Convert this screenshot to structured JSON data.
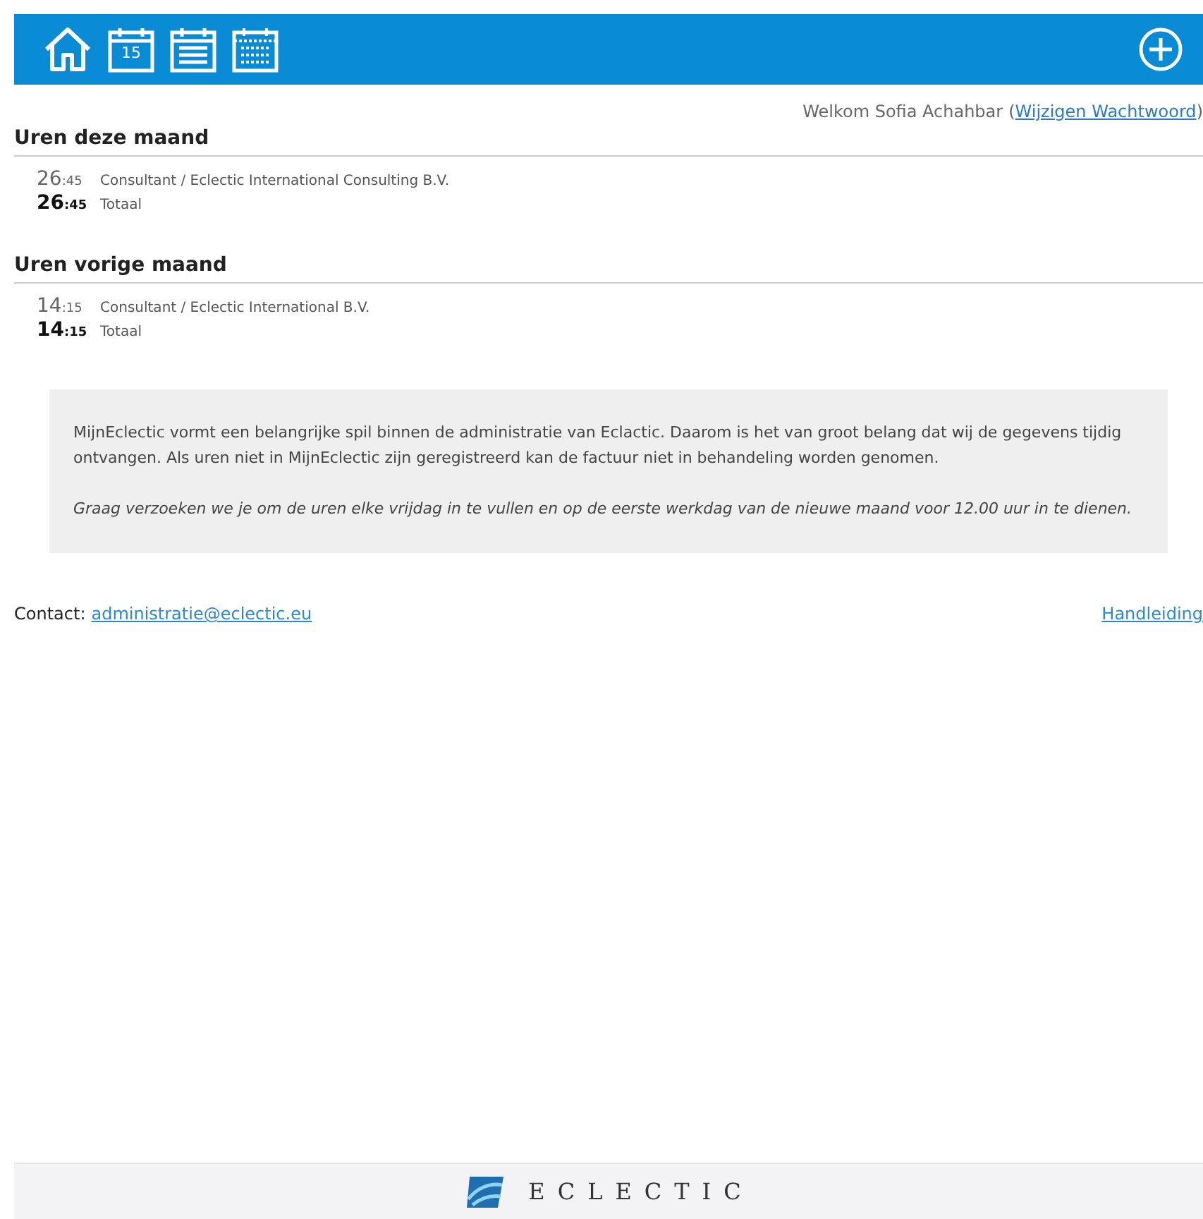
{
  "toolbar": {
    "icons": [
      {
        "kind": "home"
      },
      {
        "kind": "day",
        "day": "15"
      },
      {
        "kind": "week"
      },
      {
        "kind": "month"
      }
    ]
  },
  "welcome": {
    "text": "Welkom Sofia Achahbar",
    "open_paren": "(",
    "link": "Wijzigen Wachtwoord",
    "close_paren": ")"
  },
  "sections": [
    {
      "title": "Uren deze maand",
      "rows": [
        {
          "kind": "entry",
          "hours": "26",
          "minutes": ":45",
          "label": "Consultant / Eclectic International Consulting B.V."
        },
        {
          "kind": "total",
          "hours": "26",
          "minutes": ":45",
          "label": "Totaal"
        }
      ]
    },
    {
      "title": "Uren vorige maand",
      "rows": [
        {
          "kind": "entry",
          "hours": "14",
          "minutes": ":15",
          "label": "Consultant / Eclectic International B.V."
        },
        {
          "kind": "total",
          "hours": "14",
          "minutes": ":15",
          "label": "Totaal"
        }
      ]
    }
  ],
  "notice": {
    "paragraphs": [
      {
        "kind": "normal",
        "text": "MijnEclectic vormt een belangrijke spil binnen de administratie van Eclactic. Daarom is het van groot belang dat wij de gegevens tijdig ontvangen. Als uren niet in MijnEclectic zijn geregistreerd kan de factuur niet in behandeling worden genomen."
      },
      {
        "kind": "italic",
        "text": "Graag verzoeken we je om de uren elke vrijdag in te vullen en op de eerste werkdag van de nieuwe maand voor 12.00 uur in te dienen."
      }
    ]
  },
  "contact": {
    "label": "Contact:",
    "email": "administratie@eclectic.eu",
    "manual_link": "Handleiding"
  },
  "footer": {
    "logo_text": "ECLECTIC"
  }
}
